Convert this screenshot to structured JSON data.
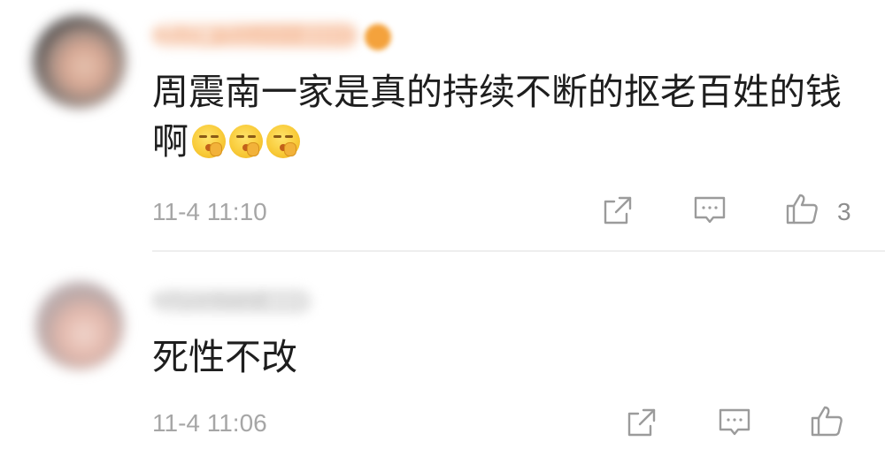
{
  "comments": [
    {
      "username": "bubu_guiii0222",
      "text_line1": "周震南一家是真的持续不断的抠老百姓的钱",
      "text_line2": "啊",
      "emoji_icons": [
        "shush-emoji-icon",
        "shush-emoji-icon",
        "shush-emoji-icon"
      ],
      "timestamp": "11-4 11:10",
      "like_count": "3"
    },
    {
      "username": "hillyonband",
      "text": "死性不改",
      "timestamp": "11-4 11:06",
      "like_count": ""
    }
  ],
  "icons": {
    "share": "share-icon",
    "reply": "reply-icon",
    "like": "thumbs-up-icon"
  },
  "colors": {
    "timestamp": "#a6a6a6",
    "icon_stroke": "#9b9b9b",
    "vip_badge": "#f4a23c"
  }
}
